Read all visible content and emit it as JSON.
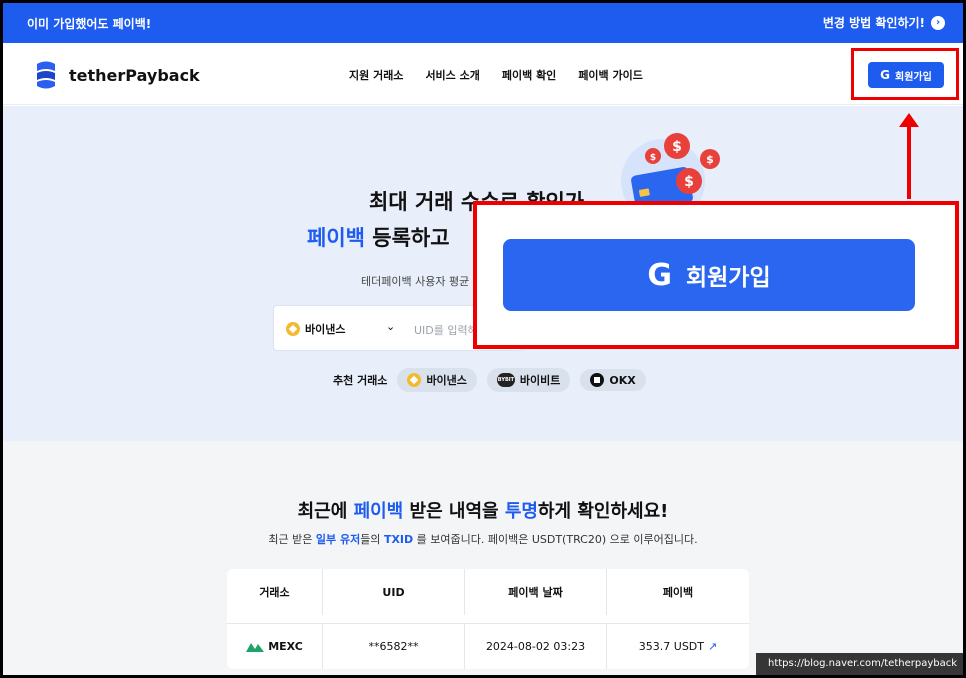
{
  "topbar": {
    "left_text": "이미 가입했어도 페이백!",
    "right_text": "변경 방법 확인하기!",
    "right_icon": "chevron-right-icon"
  },
  "nav": {
    "brand": "tetherPayback",
    "menu": [
      "지원 거래소",
      "서비스 소개",
      "페이백 확인",
      "페이백 가이드"
    ],
    "signup_label": "회원가입",
    "signup_icon": "google-icon"
  },
  "hero": {
    "title_line1": "최대 거래 수수료 확인가",
    "title_line2_accent": "페이백",
    "title_line2_rest": " 등록하고",
    "subtitle": "테더페이백 사용자 평균",
    "exchange_selected": "바이낸스",
    "uid_placeholder": "UID를 입력해",
    "recommend_label": "추천 거래소",
    "recommend_chips": [
      "바이낸스",
      "바이비트",
      "OKX"
    ]
  },
  "zoom": {
    "signup_label": "회원가입"
  },
  "recent": {
    "title_part1": "최근에 ",
    "title_accent1": "페이백",
    "title_part2": " 받은 내역을 ",
    "title_accent2": "투명",
    "title_part3": "하게 확인하세요!",
    "sub_part1": "최근 받은 ",
    "sub_accent1": "일부 유저",
    "sub_part2": "들의 ",
    "sub_accent2": "TXID",
    "sub_part3": " 를 보여줍니다. 페이백은 USDT(TRC20) 으로 이루어집니다.",
    "columns": [
      "거래소",
      "UID",
      "페이백 날짜",
      "페이백"
    ],
    "rows": [
      {
        "exchange": "MEXC",
        "uid": "**6582**",
        "date": "2024-08-02 03:23",
        "payback": "353.7 USDT"
      }
    ]
  },
  "watermark": "https://blog.naver.com/tetherpayback",
  "colors": {
    "brand_blue": "#1e5cf0",
    "highlight_red": "#e00000",
    "hero_bg": "#e8effb"
  }
}
